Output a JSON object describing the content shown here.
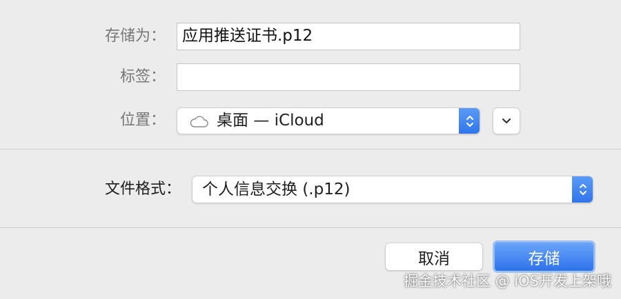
{
  "save_as": {
    "label": "存储为：",
    "value": "应用推送证书.p12"
  },
  "tags": {
    "label": "标签：",
    "value": ""
  },
  "location": {
    "label": "位置：",
    "icon": "cloud-icon",
    "value": "桌面 — iCloud"
  },
  "file_format": {
    "label": "文件格式：",
    "value": "个人信息交换 (.p12)"
  },
  "buttons": {
    "cancel": "取消",
    "save": "存储"
  },
  "watermark": "掘金技术社区 @ iOS开发上架哦",
  "colors": {
    "accent": "#3478f6",
    "background": "#ececec"
  }
}
